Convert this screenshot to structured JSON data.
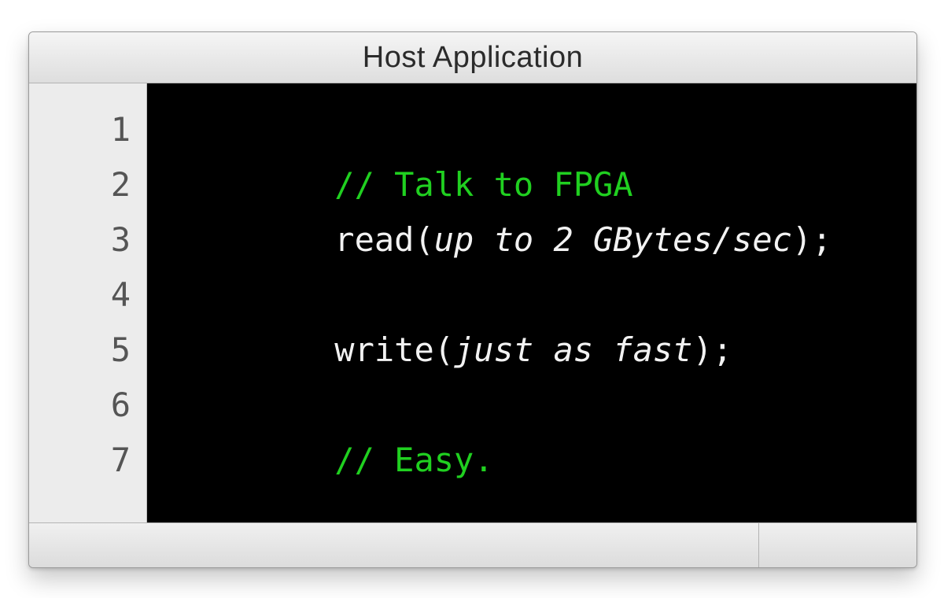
{
  "window": {
    "title": "Host Application"
  },
  "editor": {
    "line_count": 7,
    "cursor_line": 7,
    "line_numbers": [
      "1",
      "2",
      "3",
      "4",
      "5",
      "6",
      "7"
    ],
    "lines": [
      {
        "n": 1,
        "tokens": [
          {
            "cls": "tok-comment",
            "text": "// Talk to FPGA"
          }
        ]
      },
      {
        "n": 2,
        "tokens": [
          {
            "cls": "tok-plain",
            "text": "read("
          },
          {
            "cls": "tok-arg",
            "text": "up to 2 GBytes/sec"
          },
          {
            "cls": "tok-plain",
            "text": ");"
          }
        ]
      },
      {
        "n": 3,
        "tokens": []
      },
      {
        "n": 4,
        "tokens": [
          {
            "cls": "tok-plain",
            "text": "write("
          },
          {
            "cls": "tok-arg",
            "text": "just as fast"
          },
          {
            "cls": "tok-plain",
            "text": ");"
          }
        ]
      },
      {
        "n": 5,
        "tokens": []
      },
      {
        "n": 6,
        "tokens": [
          {
            "cls": "tok-comment",
            "text": "// Easy."
          }
        ]
      },
      {
        "n": 7,
        "tokens": []
      }
    ]
  }
}
